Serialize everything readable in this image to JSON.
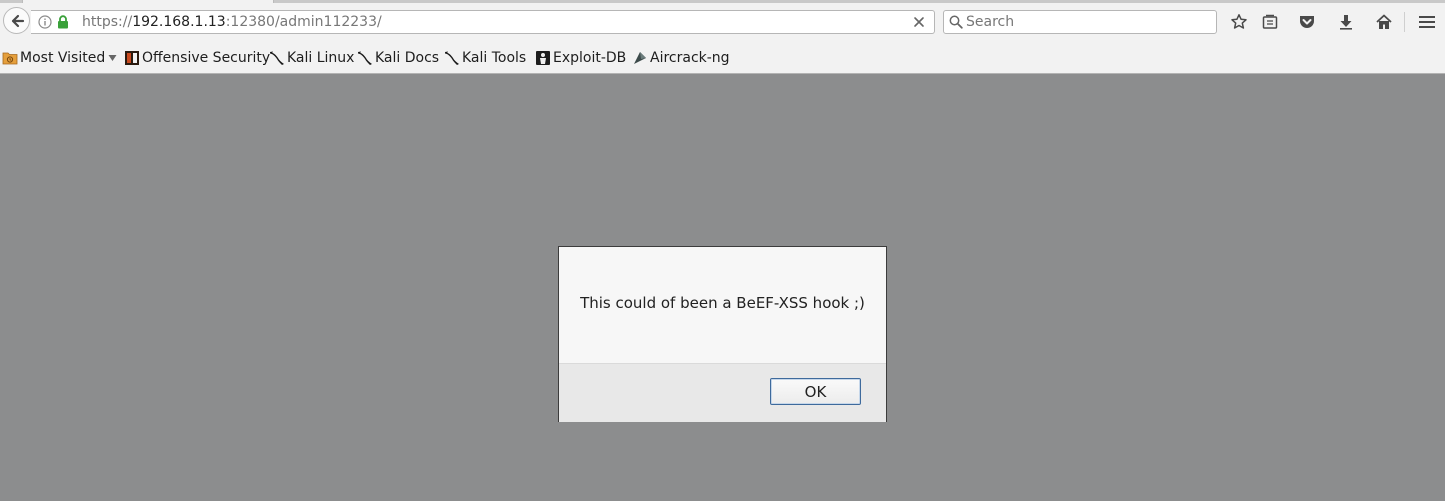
{
  "browser": {
    "url": {
      "prefix": "https://",
      "host": "192.168.1.13",
      "path": ":12380/admin112233/"
    },
    "search": {
      "placeholder": "Search",
      "value": ""
    },
    "toolbar_icons": [
      "bookmark-star-icon",
      "reading-list-icon",
      "pocket-icon",
      "download-icon",
      "home-icon",
      "menu-icon"
    ]
  },
  "bookmarks": [
    {
      "label": "Most Visited",
      "icon": "folder-icon",
      "has_dropdown": true
    },
    {
      "label": "Offensive Security",
      "icon": "offsec-icon"
    },
    {
      "label": "Kali Linux",
      "icon": "kali-dragon-icon"
    },
    {
      "label": "Kali Docs",
      "icon": "kali-dragon-icon"
    },
    {
      "label": "Kali Tools",
      "icon": "kali-dragon-icon"
    },
    {
      "label": "Exploit-DB",
      "icon": "exploitdb-icon"
    },
    {
      "label": "Aircrack-ng",
      "icon": "aircrack-icon"
    }
  ],
  "dialog": {
    "message": "This could of been a BeEF-XSS hook ;)",
    "ok_label": "OK"
  },
  "colors": {
    "page_overlay": "#8c8d8e",
    "chrome": "#f2f2f2",
    "dialog_body": "#f7f7f7",
    "dialog_footer": "#e8e8e8",
    "ok_border": "#3e6a9c"
  }
}
